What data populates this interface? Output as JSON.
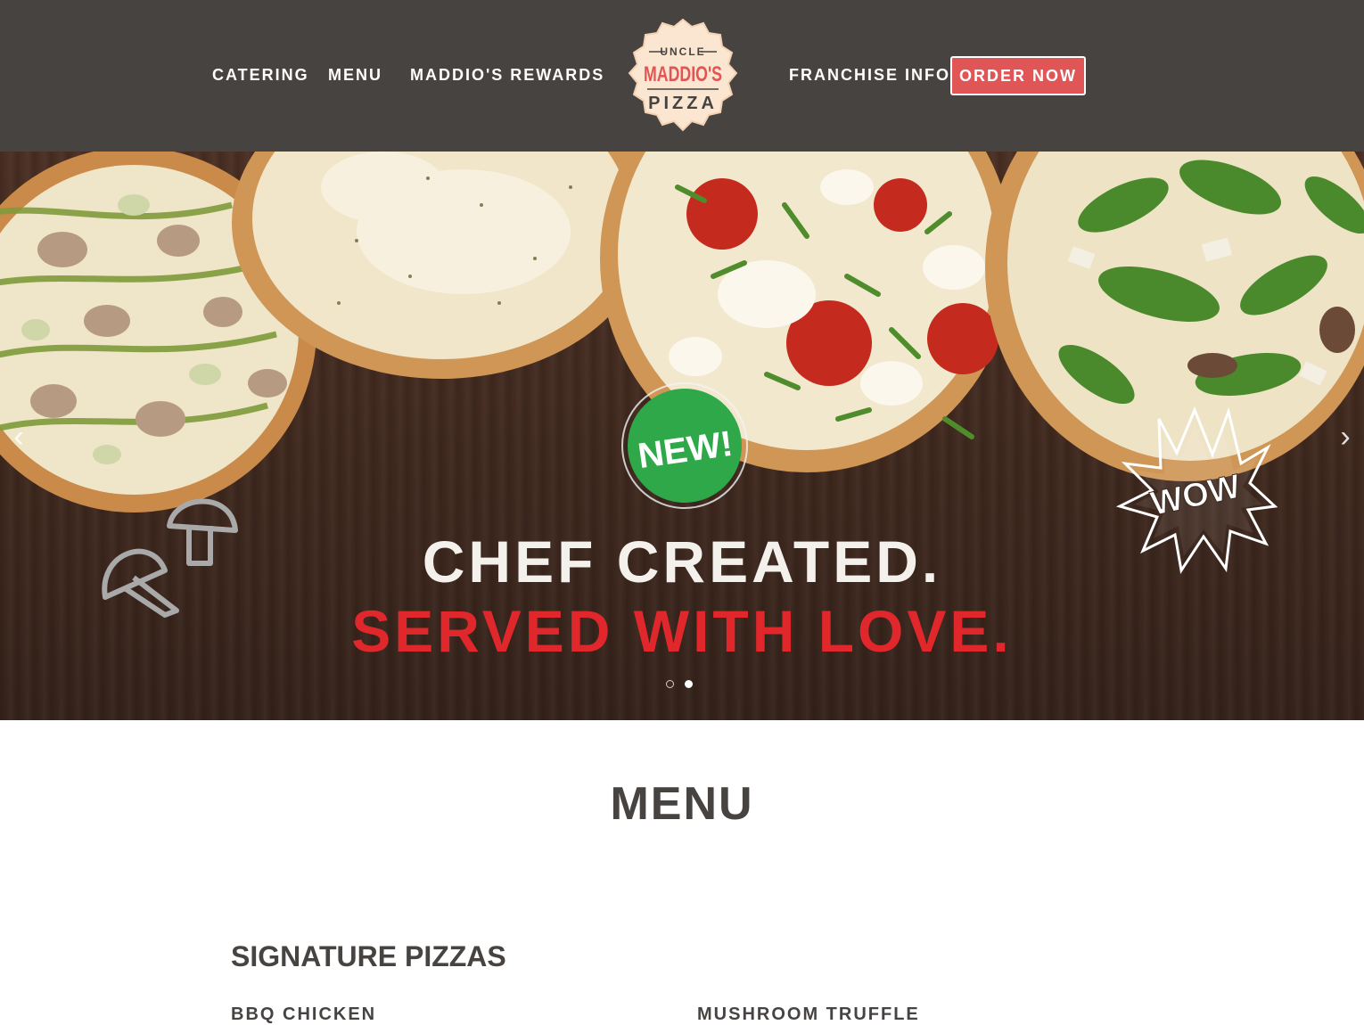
{
  "header": {
    "nav_left": [
      "CATERING",
      "MENU",
      "MADDIO'S REWARDS"
    ],
    "franchise_label": "FRANCHISE INFO",
    "order_label": "ORDER NOW",
    "logo": {
      "top": "UNCLE",
      "middle": "MADDIO'S",
      "bottom": "PIZZA"
    }
  },
  "hero": {
    "badge_new": "NEW!",
    "badge_wow": "WOW",
    "headline_line1": "CHEF CREATED.",
    "headline_line2": "SERVED WITH LOVE.",
    "prev_icon": "chevron-left-icon",
    "next_icon": "chevron-right-icon",
    "slide_count": 2,
    "active_slide": 2
  },
  "menu": {
    "title": "MENU",
    "section_title": "SIGNATURE PIZZAS",
    "items": [
      "BBQ CHICKEN",
      "MUSHROOM TRUFFLE"
    ]
  },
  "colors": {
    "header_bg": "#474341",
    "accent_red": "#e05656",
    "headline_red": "#e0272b",
    "text_dark": "#474341",
    "badge_green": "#2fa84a"
  }
}
